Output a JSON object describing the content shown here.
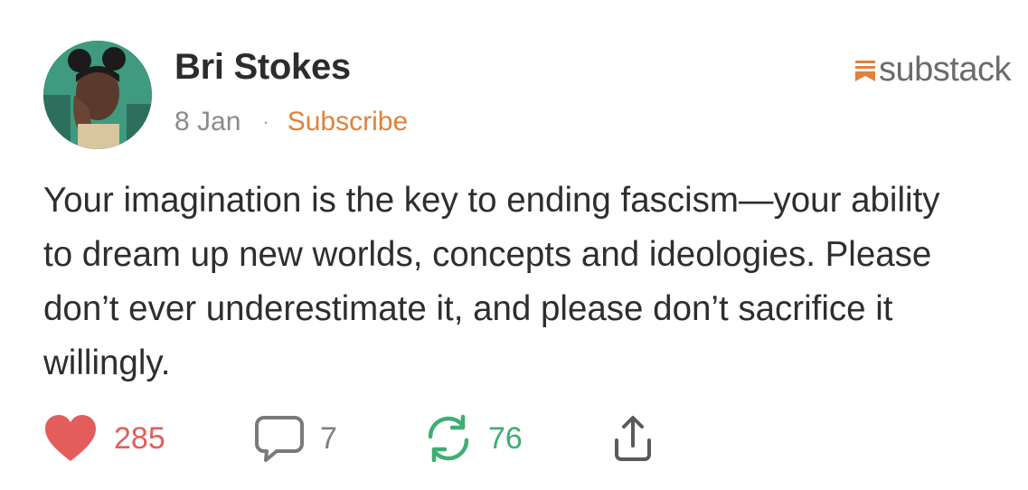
{
  "post": {
    "author": "Bri Stokes",
    "date": "8 Jan",
    "separator": "·",
    "subscribe_label": "Subscribe",
    "text": "Your imagination is the key to ending fascism—your ability to dream up new worlds, concepts and ideologies. Please don’t ever underestimate it, and please don’t sacrifice it willingly."
  },
  "brand": {
    "name": "substack",
    "icon": "substack-logo-icon",
    "color": "#e0823a"
  },
  "actions": {
    "likes": "285",
    "comments": "7",
    "restacks": "76",
    "like_icon": "heart-icon",
    "comment_icon": "comment-bubble-icon",
    "restack_icon": "restack-arrows-icon",
    "share_icon": "share-icon"
  },
  "colors": {
    "like": "#e35d5d",
    "restack": "#3fae72",
    "subscribe": "#e0823a",
    "text": "#2e2e2e",
    "muted": "#8b8b8b"
  }
}
